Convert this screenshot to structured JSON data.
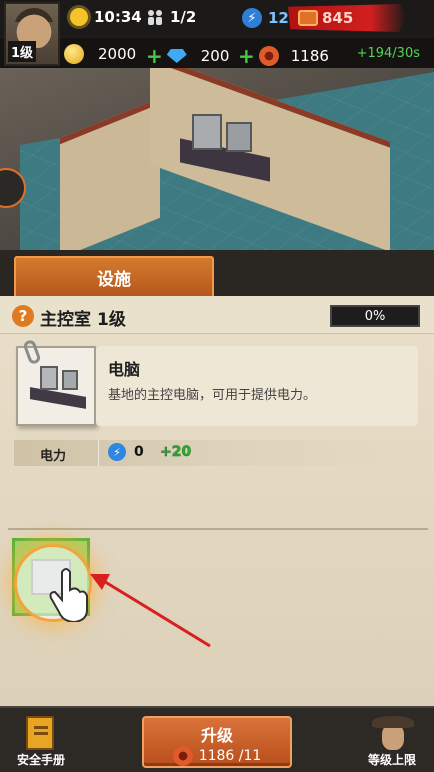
{
  "top_bar": {
    "player_level": "1级",
    "time": "10:34",
    "population": "1/2",
    "energy": "12",
    "ticket_count": "845"
  },
  "resources": {
    "coins": "2000",
    "gems": "200",
    "parts": "1186",
    "rate": "+194/30s"
  },
  "tabs": {
    "facility": "设施"
  },
  "room": {
    "name": "主控室",
    "level": "1级",
    "progress_text": "0%",
    "progress": 0
  },
  "item": {
    "name": "电脑",
    "description": "基地的主控电脑，可用于提供电力。"
  },
  "stats": {
    "power_label": "电力",
    "power_value": "0",
    "power_bonus": "+20"
  },
  "bottom": {
    "manual_label": "安全手册",
    "upgrade_label": "升级",
    "upgrade_cost": "1186 /11",
    "max_level_label": "等级上限"
  },
  "colors": {
    "accent_orange": "#d47a2e",
    "positive_green": "#2fae35",
    "energy_blue": "#2e86e0",
    "ticket_red": "#d21f1f",
    "panel_bg": "#e9dfca",
    "floor_teal": "#3e7a82"
  },
  "icons": {
    "time": "sun-icon",
    "population": "people-icon",
    "energy": "lightning-icon",
    "ticket": "ticket-icon",
    "coins": "coin-icon",
    "gems": "gem-icon",
    "parts": "gear-part-icon",
    "help": "question-icon",
    "manual": "book-icon",
    "max_level": "sheriff-avatar-icon",
    "tutorial": "pointing-hand-icon"
  }
}
